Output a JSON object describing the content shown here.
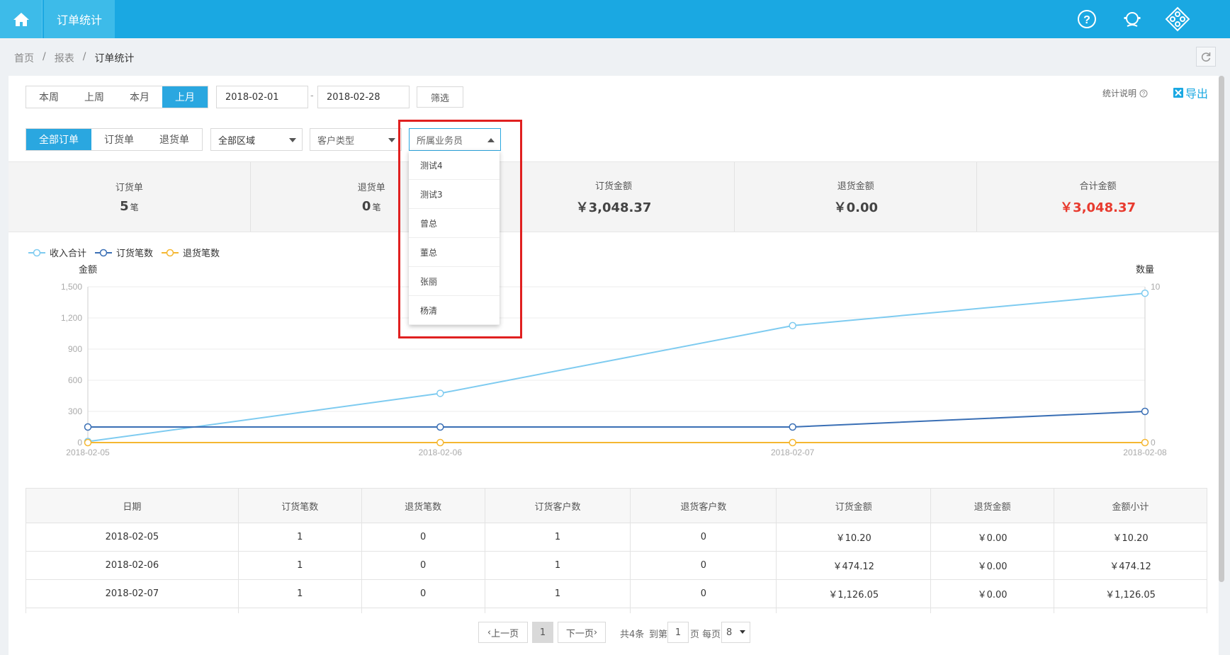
{
  "topbar": {
    "tab_label": "订单统计"
  },
  "breadcrumb": {
    "items": [
      "首页",
      "报表",
      "订单统计"
    ],
    "separator": "/"
  },
  "filters": {
    "period_tabs": [
      "本周",
      "上周",
      "本月",
      "上月"
    ],
    "date_from": "2018-02-01",
    "date_to": "2018-02-28",
    "date_separator": "-",
    "filter_button": "筛选",
    "help_label": "统计说明",
    "export_label": "导出",
    "order_tabs": [
      "全部订单",
      "订货单",
      "退货单"
    ],
    "region_select": "全部区域",
    "customer_type_select": "客户类型",
    "salesperson_select": "所属业务员"
  },
  "dropdown": {
    "options": [
      "测试4",
      "测试3",
      "曾总",
      "董总",
      "张丽",
      "杨清"
    ]
  },
  "stats": [
    {
      "label": "订货单",
      "value": "5",
      "unit": "笔"
    },
    {
      "label": "退货单",
      "value": "0",
      "unit": "笔"
    },
    {
      "label": "订货金额",
      "value": "￥3,048.37",
      "unit": ""
    },
    {
      "label": "退货金额",
      "value": "￥0.00",
      "unit": ""
    },
    {
      "label": "合计金额",
      "value": "￥3,048.37",
      "unit": ""
    }
  ],
  "chart_data": {
    "type": "line",
    "categories": [
      "2018-02-05",
      "2018-02-06",
      "2018-02-07",
      "2018-02-08"
    ],
    "ylabel_left": "金额",
    "ylabel_right": "数量",
    "ylim_left": [
      0,
      1500
    ],
    "yticks_left": [
      "0",
      "300",
      "600",
      "900",
      "1,200",
      "1,500"
    ],
    "ylim_right": [
      0,
      10
    ],
    "yticks_right": [
      "0",
      "10"
    ],
    "grid": true,
    "legend_position": "top-left",
    "series": [
      {
        "name": "收入合计",
        "axis": "left",
        "color": "#7ecbf0",
        "values": [
          10.2,
          474.12,
          1126.05,
          1437.99
        ]
      },
      {
        "name": "订货笔数",
        "axis": "right",
        "color": "#3a6fb5",
        "values": [
          1,
          1,
          1,
          2
        ]
      },
      {
        "name": "退货笔数",
        "axis": "right",
        "color": "#f5b731",
        "values": [
          0,
          0,
          0,
          0
        ]
      }
    ]
  },
  "table": {
    "headers": [
      "日期",
      "订货笔数",
      "退货笔数",
      "订货客户数",
      "退货客户数",
      "订货金额",
      "退货金额",
      "金额小计"
    ],
    "rows": [
      [
        "2018-02-05",
        "1",
        "0",
        "1",
        "0",
        "￥10.20",
        "￥0.00",
        "￥10.20"
      ],
      [
        "2018-02-06",
        "1",
        "0",
        "1",
        "0",
        "￥474.12",
        "￥0.00",
        "￥474.12"
      ],
      [
        "2018-02-07",
        "1",
        "0",
        "1",
        "0",
        "￥1,126.05",
        "￥0.00",
        "￥1,126.05"
      ],
      [
        "",
        "",
        "",
        "",
        "",
        "",
        "",
        ""
      ]
    ]
  },
  "pagination": {
    "prev_label": "上一页",
    "current_page": "1",
    "next_label": "下一页",
    "total_text": "共4条",
    "goto_text": "到第",
    "goto_value": "1",
    "per_page_text": "页 每页",
    "per_page_value": "8"
  },
  "colors": {
    "accent": "#1aa8e2",
    "highlight": "#e02020",
    "total_red": "#e83a2e"
  }
}
